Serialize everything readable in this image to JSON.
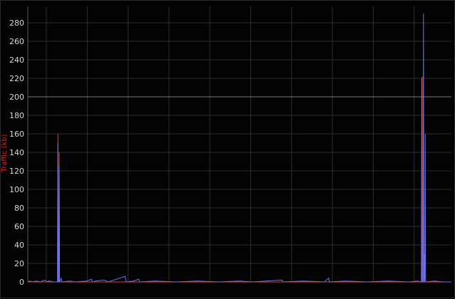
{
  "chart_data": {
    "type": "line",
    "title": "",
    "xlabel": "",
    "ylabel": "Traffic (kb)",
    "ylim": [
      0,
      290
    ],
    "yticks": [
      0,
      20,
      40,
      60,
      80,
      100,
      120,
      140,
      160,
      180,
      200,
      220,
      240,
      260,
      280
    ],
    "threshold_line": 200,
    "grid": true,
    "legend": "none",
    "colors": {
      "background": "#030303",
      "grid": "#2e2e2e",
      "threshold": "#7a7a7a",
      "tick_text": "#d8d8d8",
      "axis_title": "#e0231f"
    },
    "x_range": [
      0,
      1000
    ],
    "series": [
      {
        "color": "#e03a2c",
        "points": [
          [
            0,
            0
          ],
          [
            70,
            0
          ],
          [
            71,
            160
          ],
          [
            72,
            0
          ],
          [
            73,
            0
          ],
          [
            74,
            140
          ],
          [
            75,
            0
          ],
          [
            930,
            0
          ],
          [
            931,
            222
          ],
          [
            932,
            0
          ],
          [
            1000,
            0
          ]
        ]
      },
      {
        "color": "#6673f2",
        "points": [
          [
            0,
            0
          ],
          [
            5,
            1
          ],
          [
            10,
            0
          ],
          [
            20,
            1
          ],
          [
            30,
            0
          ],
          [
            40,
            2
          ],
          [
            45,
            0
          ],
          [
            50,
            1
          ],
          [
            60,
            0
          ],
          [
            70,
            0
          ],
          [
            71,
            150
          ],
          [
            72,
            0
          ],
          [
            73,
            0
          ],
          [
            74,
            125
          ],
          [
            75,
            0
          ],
          [
            76,
            1
          ],
          [
            79,
            4
          ],
          [
            80,
            0
          ],
          [
            100,
            1
          ],
          [
            110,
            0
          ],
          [
            140,
            1
          ],
          [
            150,
            3
          ],
          [
            152,
            0
          ],
          [
            160,
            1
          ],
          [
            180,
            2
          ],
          [
            190,
            0
          ],
          [
            230,
            6
          ],
          [
            232,
            0
          ],
          [
            250,
            1
          ],
          [
            262,
            3
          ],
          [
            264,
            0
          ],
          [
            300,
            1
          ],
          [
            350,
            0
          ],
          [
            400,
            1
          ],
          [
            450,
            0
          ],
          [
            500,
            1
          ],
          [
            530,
            0
          ],
          [
            600,
            2
          ],
          [
            602,
            0
          ],
          [
            650,
            1
          ],
          [
            700,
            0
          ],
          [
            710,
            4
          ],
          [
            712,
            0
          ],
          [
            750,
            1
          ],
          [
            800,
            0
          ],
          [
            850,
            1
          ],
          [
            900,
            0
          ],
          [
            920,
            1
          ],
          [
            928,
            0
          ],
          [
            929,
            0
          ],
          [
            930,
            220
          ],
          [
            931,
            0
          ],
          [
            933,
            0
          ],
          [
            934,
            290
          ],
          [
            935,
            0
          ],
          [
            936,
            30
          ],
          [
            937,
            0
          ],
          [
            938,
            160
          ],
          [
            939,
            0
          ],
          [
            960,
            1
          ],
          [
            980,
            0
          ],
          [
            1000,
            0
          ]
        ]
      }
    ]
  }
}
